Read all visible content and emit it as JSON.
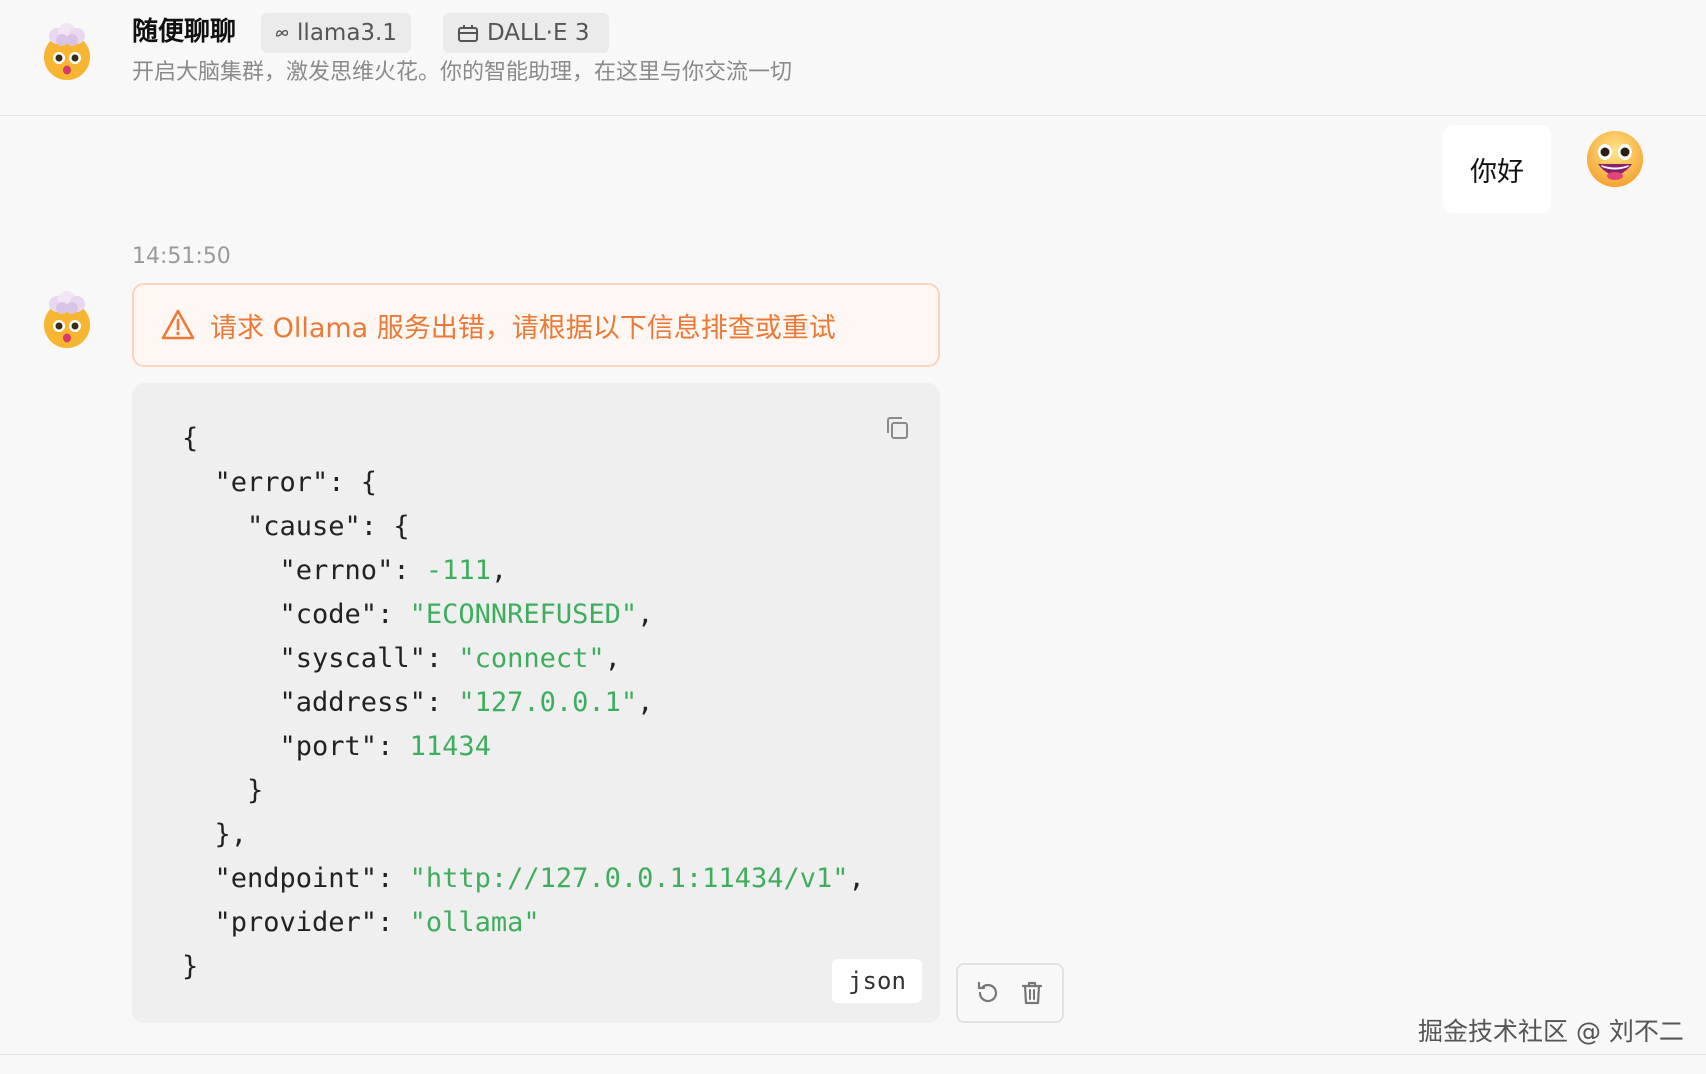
{
  "header": {
    "title": "随便聊聊",
    "avatar_icon": "mind-blown-emoji-icon",
    "model_tag": {
      "icon": "meta-logo-icon",
      "label": "llama3.1"
    },
    "plugin_tag": {
      "icon": "plugin-box-icon",
      "label": "DALL·E 3"
    },
    "description": "开启大脑集群，激发思维火花。你的智能助理，在这里与你交流一切"
  },
  "chat": {
    "user_message": {
      "text": "你好",
      "avatar_icon": "grinning-face-emoji-icon"
    },
    "assistant_message": {
      "timestamp": "14:51:50",
      "avatar_icon": "mind-blown-emoji-icon",
      "error_icon": "warning-triangle-icon",
      "error_text": "请求 Ollama 服务出错，请根据以下信息排查或重试",
      "code_language": "json",
      "code": {
        "errno": "-111",
        "code": "\"ECONNREFUSED\"",
        "syscall": "\"connect\"",
        "address": "\"127.0.0.1\"",
        "port": "11434",
        "endpoint": "\"http://127.0.0.1:11434/v1\"",
        "provider": "\"ollama\""
      },
      "copy_icon": "copy-icon",
      "actions": [
        {
          "name": "regenerate",
          "icon": "refresh-icon"
        },
        {
          "name": "delete",
          "icon": "trash-icon"
        }
      ]
    }
  },
  "watermark": "掘金技术社区 @ 刘不二",
  "colors": {
    "error_text": "#ec7a36",
    "error_border": "#fbd3be",
    "error_bg": "#fff7f3",
    "code_value": "#3fae5c",
    "code_bg": "#efefef"
  }
}
